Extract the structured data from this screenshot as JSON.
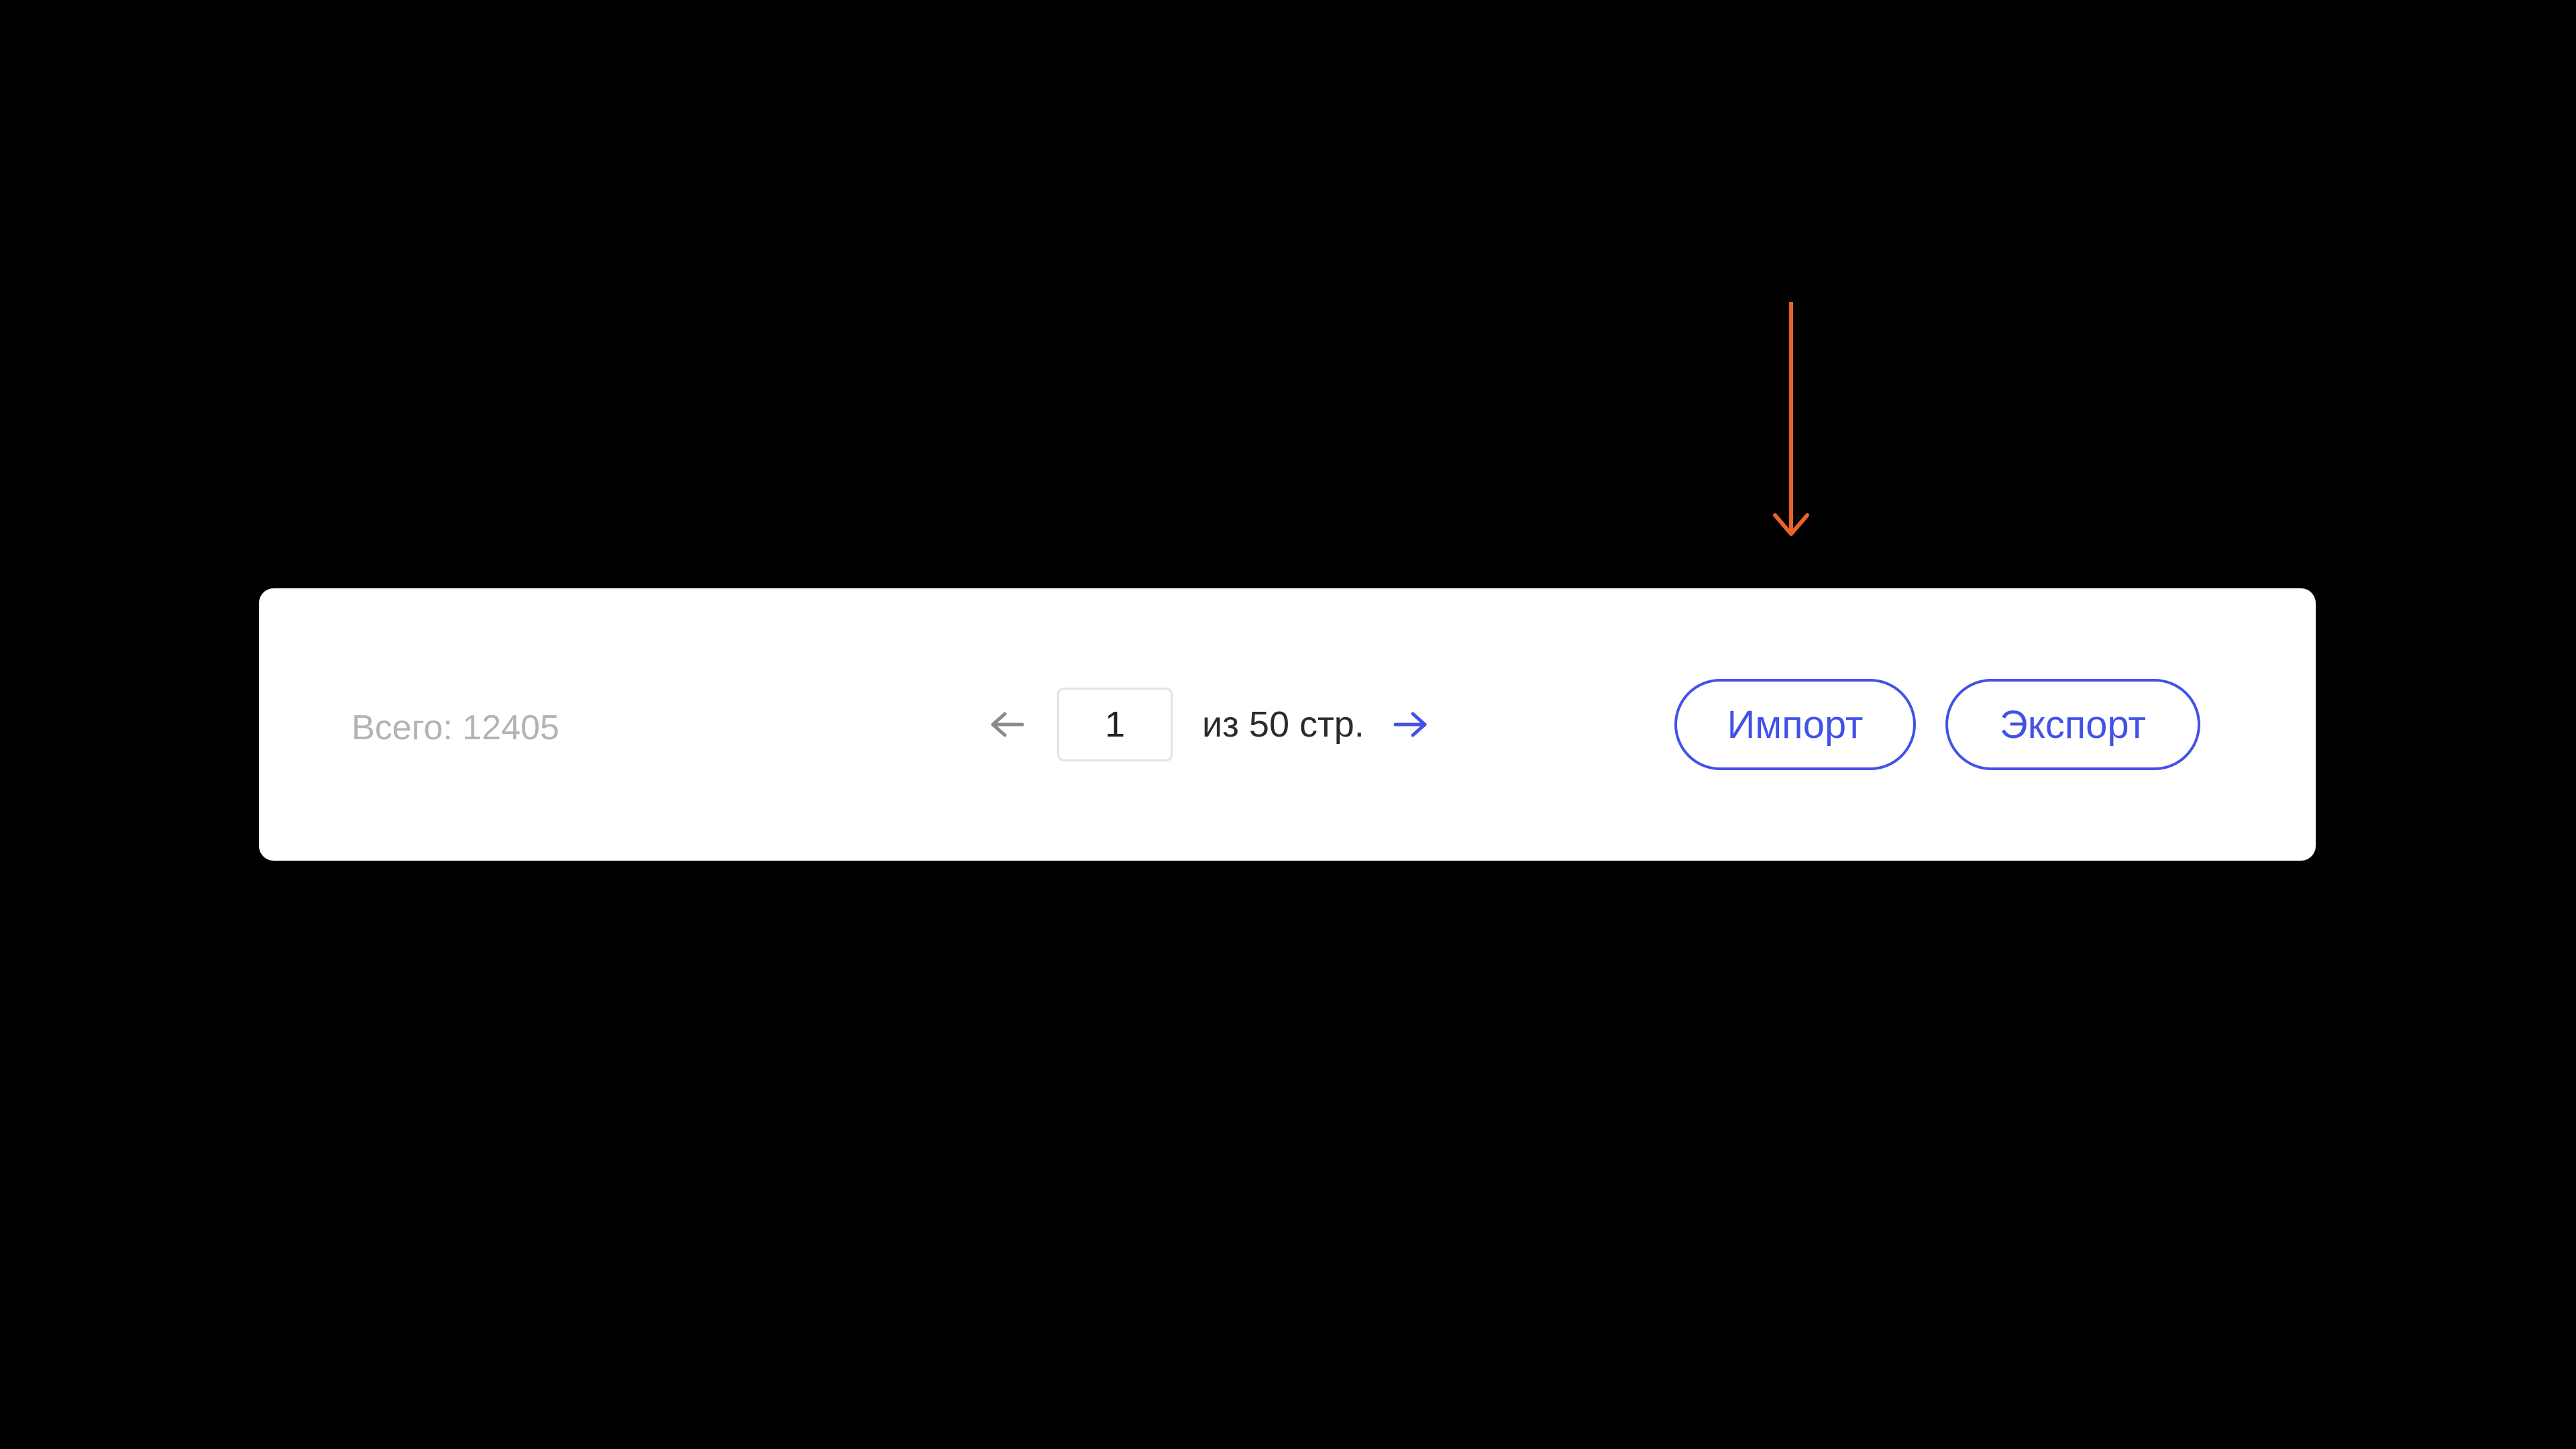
{
  "footer": {
    "total_text": "Всего: 12405",
    "pagination": {
      "current_page": "1",
      "of_text": "из 50 стр."
    },
    "actions": {
      "import_label": "Импорт",
      "export_label": "Экспорт"
    }
  },
  "icons": {
    "prev": "arrow-left-icon",
    "next": "arrow-right-icon",
    "annotation": "arrow-down-icon"
  },
  "colors": {
    "accent": "#4252e6",
    "annotation": "#e8622d",
    "muted_text": "#b3b3b3",
    "arrow_inactive": "#8a8a8a"
  }
}
